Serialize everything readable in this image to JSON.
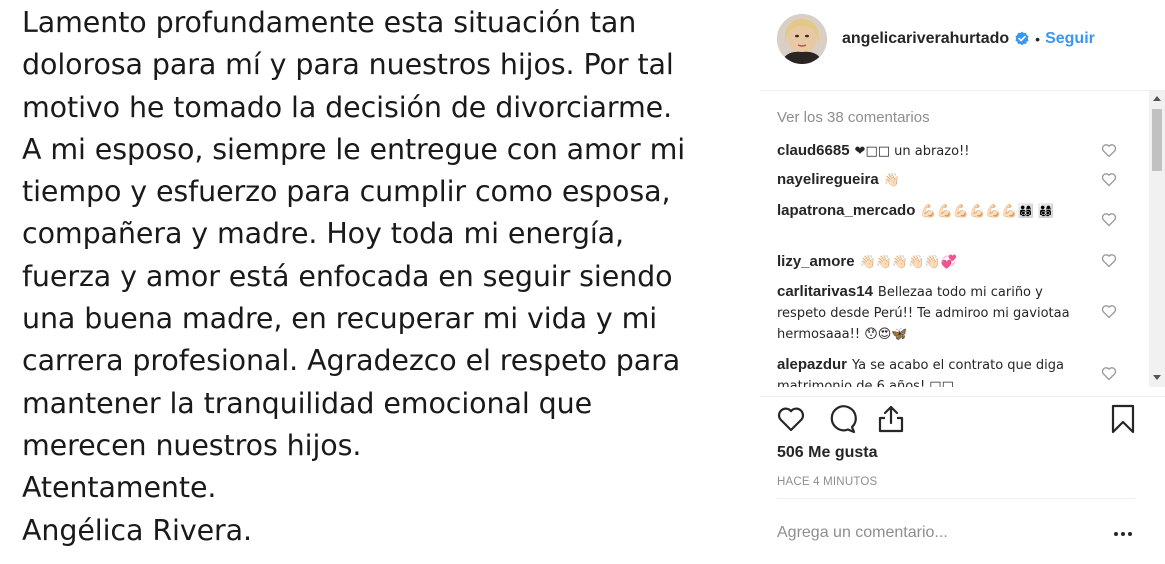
{
  "post": {
    "lines": [
      "Lamento profundamente esta situación tan",
      "dolorosa para mí y para nuestros hijos. Por tal",
      "motivo he tomado la decisión de divorciarme.",
      "A mi esposo, siempre le entregue con amor mi",
      "tiempo y esfuerzo para cumplir como esposa,",
      "compañera y madre. Hoy toda mi energía,",
      "fuerza y amor está enfocada en seguir siendo",
      "una buena madre, en recuperar mi vida y mi",
      "carrera profesional. Agradezco el respeto para",
      "mantener la tranquilidad emocional que",
      "merecen nuestros hijos.",
      "Atentamente.",
      "Angélica Rivera."
    ]
  },
  "header": {
    "username": "angelicariverahurtado",
    "separator": "•",
    "follow_label": "Seguir"
  },
  "comments": {
    "load_more": "Ver los 38 comentarios",
    "items": [
      {
        "user": "claud6685",
        "text": "❤□□ un abrazo!!"
      },
      {
        "user": "nayeliregueira",
        "text": "👋🏻"
      },
      {
        "user": "lapatrona_mercado",
        "text": "💪🏻💪🏻💪🏻💪🏻💪🏻💪🏻👨‍👩‍👦‍👦 👨‍👩‍👦‍👦"
      },
      {
        "user": "lizy_amore",
        "text": "👋🏻👋🏻👋🏻👋🏻👋🏻💞"
      },
      {
        "user": "carlitarivas14",
        "text": "Bellezaa todo mi cariño y respeto desde Perú!! Te admiroo mi gaviotaa hermosaaa!! 😯😍🦋"
      },
      {
        "user": "alepazdur",
        "text": "Ya se acabo el contrato que diga matrimonio de 6 años! □□"
      }
    ]
  },
  "stats": {
    "likes": "506 Me gusta",
    "time": "HACE 4 MINUTOS"
  },
  "composer": {
    "placeholder": "Agrega un comentario...",
    "more": "···"
  },
  "colors": {
    "accent": "#3897f0",
    "muted": "#8e8e8e",
    "heart": "#a01b1b"
  },
  "icons": {
    "verified": "verified-badge-icon",
    "like": "heart-outline-icon",
    "comment": "comment-bubble-icon",
    "share": "share-upload-icon",
    "save": "bookmark-icon",
    "more": "ellipsis-icon"
  }
}
